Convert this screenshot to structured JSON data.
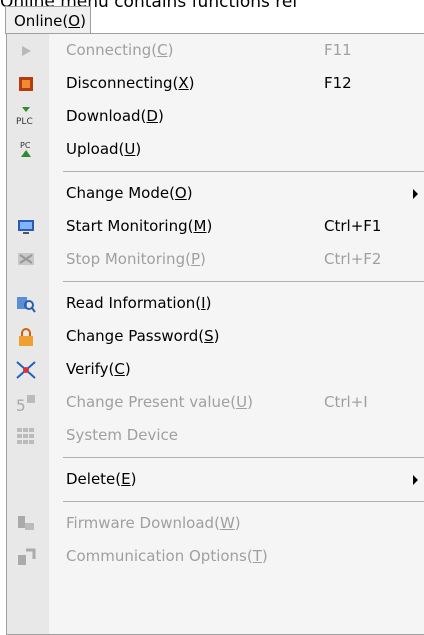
{
  "caption": "Online menu contains functions rel",
  "menu": {
    "title_pre": "Onl",
    "title_rest": "ine(",
    "title_key": "O",
    "title_end": ")"
  },
  "items": [
    {
      "pre": "Connecting(",
      "key": "C",
      "post": ")",
      "shortcut": "F11",
      "icon": "play-icon",
      "disabled": true
    },
    {
      "pre": "Disconnecting(",
      "key": "X",
      "post": ")",
      "shortcut": "F12",
      "icon": "stop-square-icon",
      "disabled": false
    },
    {
      "pre": "Download(",
      "key": "D",
      "post": ")",
      "shortcut": "",
      "icon": "plc-download-icon",
      "disabled": false
    },
    {
      "pre": "Upload(",
      "key": "U",
      "post": ")",
      "shortcut": "",
      "icon": "pc-upload-icon",
      "disabled": false
    },
    {
      "sep": true
    },
    {
      "pre": "Change Mode(",
      "key": "O",
      "post": ")",
      "shortcut": "",
      "icon": "",
      "submenu": true,
      "disabled": false
    },
    {
      "pre": "Start Monitoring(",
      "key": "M",
      "post": ")",
      "shortcut": "Ctrl+F1",
      "icon": "monitor-icon",
      "disabled": false
    },
    {
      "pre": "Stop Monitoring(",
      "key": "P",
      "post": ")",
      "shortcut": "Ctrl+F2",
      "icon": "monitor-stop-icon",
      "disabled": true
    },
    {
      "sep": true
    },
    {
      "pre": "Read Information(",
      "key": "I",
      "post": ")",
      "shortcut": "",
      "icon": "read-info-icon",
      "disabled": false
    },
    {
      "pre": "Change Password(",
      "key": "S",
      "post": ")",
      "shortcut": "",
      "icon": "lock-icon",
      "disabled": false
    },
    {
      "pre": "Verify(",
      "key": "C",
      "post": ")",
      "shortcut": "",
      "icon": "verify-icon",
      "disabled": false
    },
    {
      "pre": "Change Present value(",
      "key": "U",
      "post": ")",
      "shortcut": "Ctrl+I",
      "icon": "present-value-icon",
      "disabled": true
    },
    {
      "pre": "System Device",
      "key": "",
      "post": "",
      "shortcut": "",
      "icon": "system-device-icon",
      "disabled": true
    },
    {
      "sep": true
    },
    {
      "pre": "Delete(",
      "key": "E",
      "post": ")",
      "shortcut": "",
      "icon": "",
      "submenu": true,
      "disabled": false
    },
    {
      "sep": true
    },
    {
      "pre": "Firmware Download(",
      "key": "W",
      "post": ")",
      "shortcut": "",
      "icon": "firmware-icon",
      "disabled": true
    },
    {
      "pre": "Communication Options(",
      "key": "T",
      "post": ")",
      "shortcut": "",
      "icon": "comm-options-icon",
      "disabled": true
    }
  ]
}
